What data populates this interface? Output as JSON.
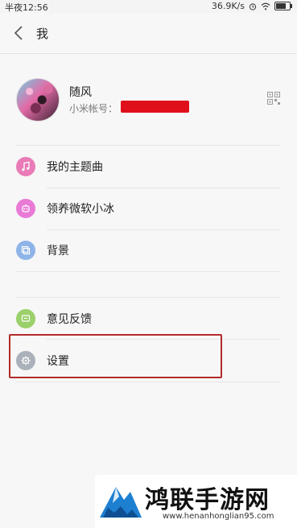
{
  "status_bar": {
    "time": "半夜12:56",
    "speed": "36.9K/s"
  },
  "header": {
    "title": "我"
  },
  "profile": {
    "username": "随风",
    "account_label": "小米帐号："
  },
  "menu": {
    "items": [
      {
        "label": "我的主题曲",
        "icon": "music-note-icon",
        "color": "#e97bb7"
      },
      {
        "label": "领养微软小冰",
        "icon": "xiaoice-icon",
        "color": "#e97bd6"
      },
      {
        "label": "背景",
        "icon": "background-icon",
        "color": "#8fb4e8"
      },
      {
        "label": "意见反馈",
        "icon": "feedback-icon",
        "color": "#9bd06a"
      },
      {
        "label": "设置",
        "icon": "gear-icon",
        "color": "#aab1ba"
      }
    ]
  },
  "watermark": {
    "title": "鸿联手游网",
    "url": "www.henanhonglian95.com"
  },
  "colors": {
    "highlight": "#b22a2a",
    "redaction": "#e0101a"
  }
}
